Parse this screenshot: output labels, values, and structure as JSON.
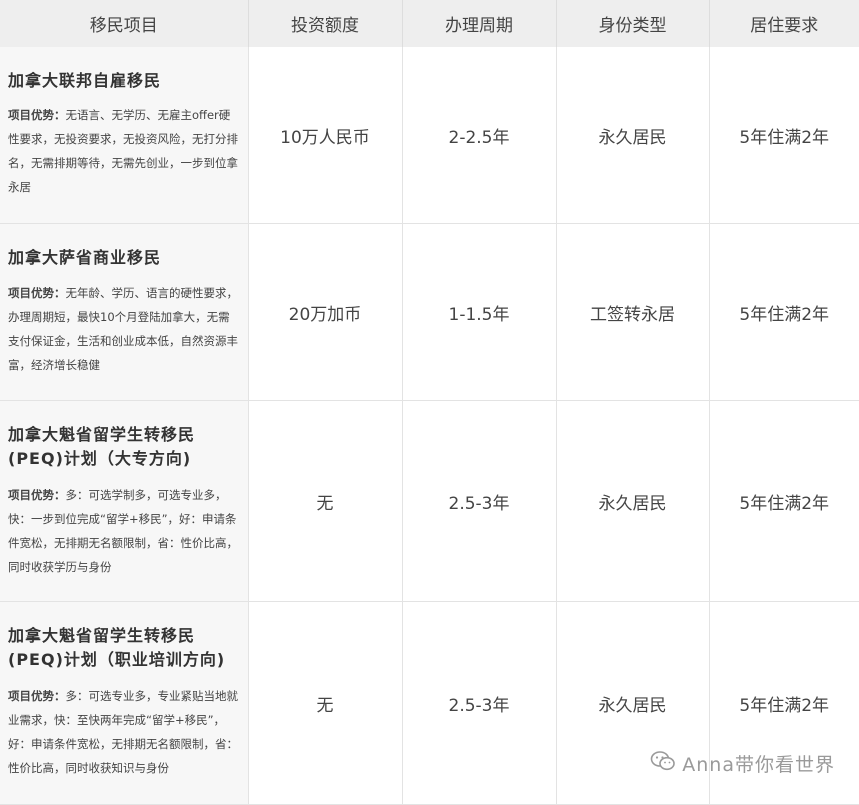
{
  "headers": [
    "移民项目",
    "投资额度",
    "办理周期",
    "身份类型",
    "居住要求"
  ],
  "advantage_label": "项目优势：",
  "rows": [
    {
      "name": "加拿大联邦自雇移民",
      "desc": "无语言、无学历、无雇主offer硬性要求，无投资要求，无投资风险，无打分排名，无需排期等待，无需先创业，一步到位拿永居",
      "investment": "10万人民币",
      "period": "2-2.5年",
      "status": "永久居民",
      "residency": "5年住满2年"
    },
    {
      "name": "加拿大萨省商业移民",
      "desc": "无年龄、学历、语言的硬性要求，办理周期短，最快10个月登陆加拿大，无需支付保证金，生活和创业成本低，自然资源丰富，经济增长稳健",
      "investment": "20万加币",
      "period": "1-1.5年",
      "status": "工签转永居",
      "residency": "5年住满2年"
    },
    {
      "name": "加拿大魁省留学生转移民(PEQ)计划（大专方向)",
      "desc": "多：可选学制多，可选专业多，快：一步到位完成“留学+移民”，好：申请条件宽松，无排期无名额限制，省：性价比高，同时收获学历与身份",
      "investment": "无",
      "period": "2.5-3年",
      "status": "永久居民",
      "residency": "5年住满2年"
    },
    {
      "name": "加拿大魁省留学生转移民(PEQ)计划（职业培训方向)",
      "desc": "多：可选专业多，专业紧贴当地就业需求，快：至快两年完成“留学+移民”，好：申请条件宽松，无排期无名额限制，省：性价比高，同时收获知识与身份",
      "investment": "无",
      "period": "2.5-3年",
      "status": "永久居民",
      "residency": "5年住满2年"
    }
  ],
  "watermark": "Anna带你看世界",
  "watermark_icon": "wechat-icon"
}
